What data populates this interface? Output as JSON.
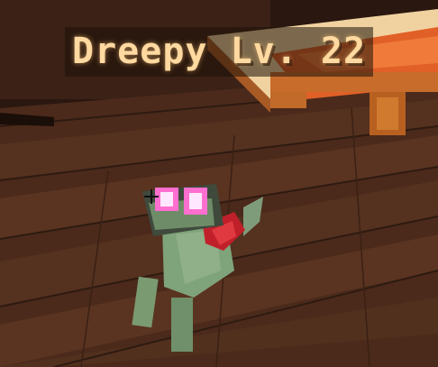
{
  "hud": {
    "nametag": "Dreepy Lv. 22"
  },
  "icons": {
    "crosshair": "crosshair-icon",
    "creature": "dreepy-creature",
    "furniture": "bed-furniture"
  },
  "colors": {
    "nametag_text": "#ffd9a0",
    "floor": "#4a2a1b",
    "bed_cover": "#e0632a",
    "creature_body": "#7fa37a",
    "creature_eyes": "#ff6fd0"
  }
}
